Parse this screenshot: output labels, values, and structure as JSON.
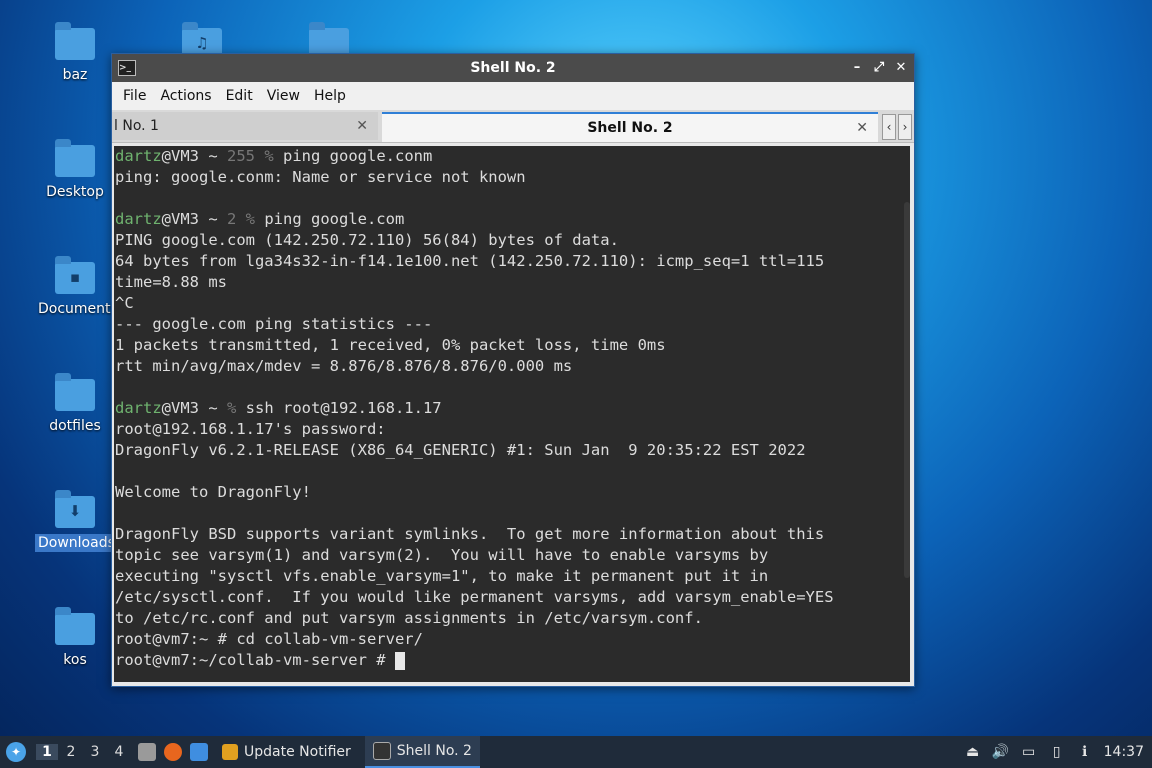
{
  "desktop": {
    "icons": [
      {
        "label": "baz",
        "symbol": "",
        "selected": false
      },
      {
        "label": "Desktop",
        "symbol": "",
        "selected": false
      },
      {
        "label": "Documents",
        "symbol": "▪",
        "selected": false
      },
      {
        "label": "dotfiles",
        "symbol": "",
        "selected": false
      },
      {
        "label": "Downloads",
        "symbol": "⬇",
        "selected": true
      },
      {
        "label": "kos",
        "symbol": "",
        "selected": false
      }
    ],
    "top_row_symbols": [
      "♫",
      ""
    ]
  },
  "window": {
    "title": "Shell No. 2",
    "buttons": {
      "minimize": "–",
      "maximize": "⤢",
      "close": "✕"
    },
    "menu": [
      "File",
      "Actions",
      "Edit",
      "View",
      "Help"
    ],
    "tabs": [
      {
        "label": "l No. 1",
        "close": "✕",
        "active": false
      },
      {
        "label": "Shell No. 2",
        "close": "✕",
        "active": true
      }
    ],
    "tab_scroll": {
      "left": "‹",
      "right": "›"
    }
  },
  "terminal": {
    "lines": [
      {
        "user": "dartz",
        "host": "@VM3 ~ ",
        "code": "255 % ",
        "cmd": "ping google.conm"
      },
      {
        "text": "ping: google.conm: Name or service not known"
      },
      {
        "text": ""
      },
      {
        "user": "dartz",
        "host": "@VM3 ~ ",
        "code": "2 % ",
        "cmd": "ping google.com"
      },
      {
        "text": "PING google.com (142.250.72.110) 56(84) bytes of data."
      },
      {
        "text": "64 bytes from lga34s32-in-f14.1e100.net (142.250.72.110): icmp_seq=1 ttl=115"
      },
      {
        "text": "time=8.88 ms"
      },
      {
        "text": "^C"
      },
      {
        "text": "--- google.com ping statistics ---"
      },
      {
        "text": "1 packets transmitted, 1 received, 0% packet loss, time 0ms"
      },
      {
        "text": "rtt min/avg/max/mdev = 8.876/8.876/8.876/0.000 ms"
      },
      {
        "text": ""
      },
      {
        "user": "dartz",
        "host": "@VM3 ~ ",
        "code": "% ",
        "cmd": "ssh root@192.168.1.17"
      },
      {
        "text": "root@192.168.1.17's password:"
      },
      {
        "text": "DragonFly v6.2.1-RELEASE (X86_64_GENERIC) #1: Sun Jan  9 20:35:22 EST 2022"
      },
      {
        "text": ""
      },
      {
        "text": "Welcome to DragonFly!"
      },
      {
        "text": ""
      },
      {
        "text": "DragonFly BSD supports variant symlinks.  To get more information about this"
      },
      {
        "text": "topic see varsym(1) and varsym(2).  You will have to enable varsyms by"
      },
      {
        "text": "executing \"sysctl vfs.enable_varsym=1\", to make it permanent put it in"
      },
      {
        "text": "/etc/sysctl.conf.  If you would like permanent varsyms, add varsym_enable=YES"
      },
      {
        "text": "to /etc/rc.conf and put varsym assignments in /etc/varsym.conf."
      },
      {
        "text": "root@vm7:~ # cd collab-vm-server/"
      },
      {
        "text": "root@vm7:~/collab-vm-server # ",
        "cursor": true
      }
    ]
  },
  "taskbar": {
    "workspaces": [
      "1",
      "2",
      "3",
      "4"
    ],
    "active_workspace": "1",
    "tasks": [
      {
        "label": "Update Notifier",
        "icon": "update-notifier-icon",
        "active": false
      },
      {
        "label": "Shell No. 2",
        "icon": "terminal-icon",
        "active": true
      }
    ],
    "clock": "14:37"
  }
}
